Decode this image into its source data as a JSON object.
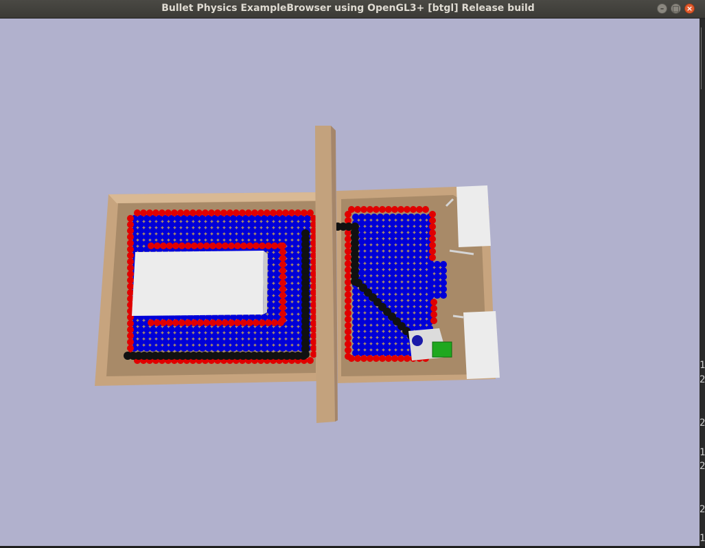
{
  "window": {
    "title": "Bullet Physics ExampleBrowser using OpenGL3+ [btgl] Release build",
    "buttons": {
      "minimize": "–",
      "maximize": "□",
      "close": "×"
    }
  },
  "colors": {
    "background": "#b1b1cd",
    "floor": "#c8a57f",
    "red_spheres": "#e00000",
    "blue_spheres": "#0000d8",
    "black_spheres": "#111111",
    "cube": "#1fa81f",
    "panels": "#e8e8e8"
  },
  "right_edge_labels": [
    "1",
    "2",
    "2",
    "1",
    "2",
    "2",
    "1"
  ]
}
